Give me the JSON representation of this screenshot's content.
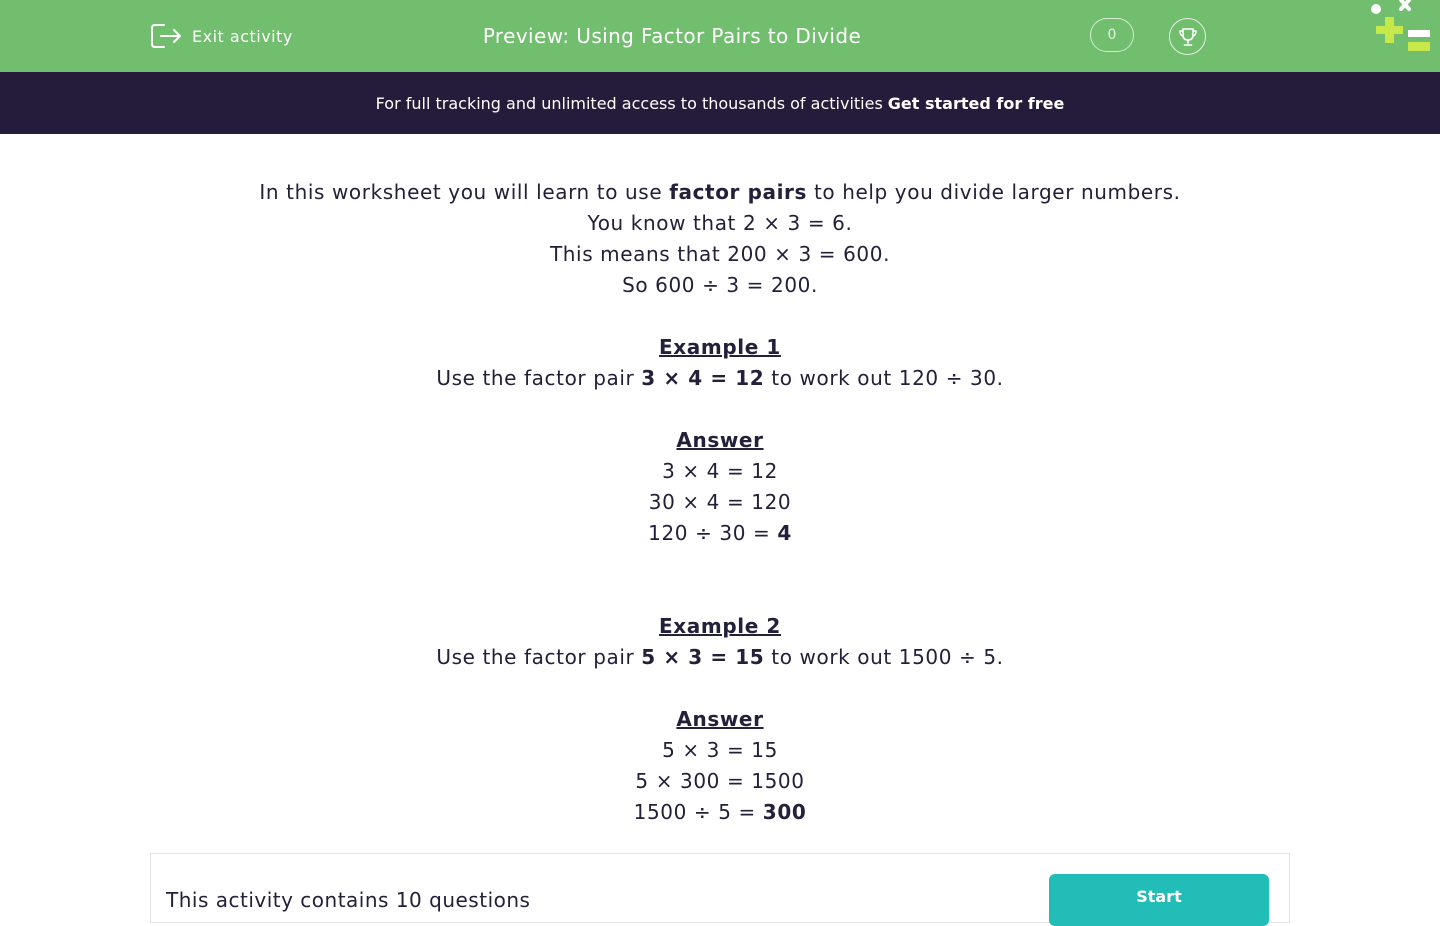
{
  "header": {
    "exit_label": "Exit activity",
    "title": "Preview: Using Factor Pairs to Divide",
    "score": "0"
  },
  "banner": {
    "text": "For full tracking and unlimited access to thousands of activities",
    "cta": "Get started for free"
  },
  "intro": {
    "l1_pre": "In this worksheet you will learn to use ",
    "l1_bold": "factor pairs",
    "l1_post": " to help you divide larger numbers.",
    "l2": "You know that 2 × 3 = 6.",
    "l3": "This means that 200 × 3 = 600.",
    "l4": "So 600 ÷ 3 = 200."
  },
  "example1": {
    "heading": "Example 1",
    "q_pre": "Use the factor pair ",
    "q_bold": "3 × 4 = 12",
    "q_post": " to work out 120 ÷ 30.",
    "answer_heading": "Answer",
    "a1": "3 × 4 = 12",
    "a2": "30 × 4 = 120",
    "a3_pre": "120 ÷ 30 = ",
    "a3_bold": "4"
  },
  "example2": {
    "heading": "Example 2",
    "q_pre": "Use the factor pair ",
    "q_bold": "5 × 3 = 15",
    "q_post": " to work out 1500 ÷ 5.",
    "answer_heading": "Answer",
    "a1": "5 × 3 = 15",
    "a2": "5 × 300 = 1500",
    "a3_pre": "1500 ÷ 5 = ",
    "a3_bold": "300"
  },
  "footer": {
    "question_count": "This activity contains 10 questions",
    "start_label": "Start"
  },
  "colors": {
    "header_green": "#72be6f",
    "banner_navy": "#241c3a",
    "text_dark": "#23203a",
    "start_teal": "#23bdb7",
    "logo_lime": "#c6e84a"
  }
}
